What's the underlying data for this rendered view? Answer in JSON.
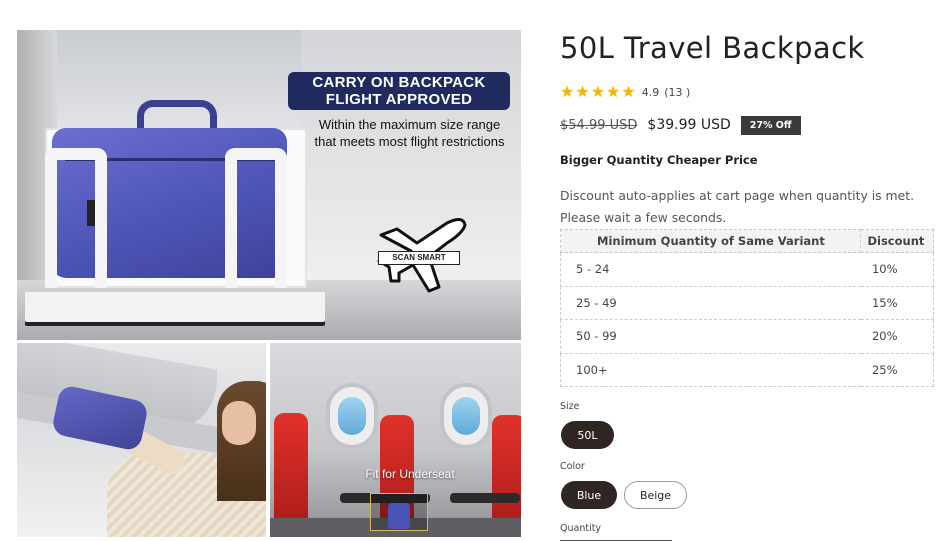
{
  "gallery": {
    "hero_badge_line1": "CARRY ON BACKPACK",
    "hero_badge_line2": "FLIGHT APPROVED",
    "hero_sub_line1": "Within the maximum size range",
    "hero_sub_line2": "that meets most flight restrictions",
    "plane_label": "SCAN SMART",
    "underseat_label": "Fit for Underseat",
    "colors": {
      "badge_bg": "#1f2a5e",
      "bag_blue": "#4f55b8",
      "seat_red": "#e2312b"
    }
  },
  "product": {
    "title": "50L Travel Backpack",
    "rating_stars": "★★★★★",
    "rating_value": "4.9",
    "rating_count": "(13 )",
    "price_original": "$54.99 USD",
    "price_sale": "$39.99 USD",
    "sale_badge": "27% Off",
    "promo_heading": "Bigger Quantity Cheaper Price",
    "promo_text": "Discount auto-applies at cart page when quantity is met. Please wait a few seconds.",
    "star_color": "#f4b400"
  },
  "discount_table": {
    "headers": [
      "Minimum Quantity of Same Variant",
      "Discount"
    ],
    "rows": [
      [
        "5 - 24",
        "10%"
      ],
      [
        "25 - 49",
        "15%"
      ],
      [
        "50 - 99",
        "20%"
      ],
      [
        "100+",
        "25%"
      ]
    ]
  },
  "options": {
    "size_label": "Size",
    "size_values": [
      "50L"
    ],
    "color_label": "Color",
    "color_values": [
      "Blue",
      "Beige"
    ],
    "selected_color": "Blue",
    "quantity_label": "Quantity"
  }
}
